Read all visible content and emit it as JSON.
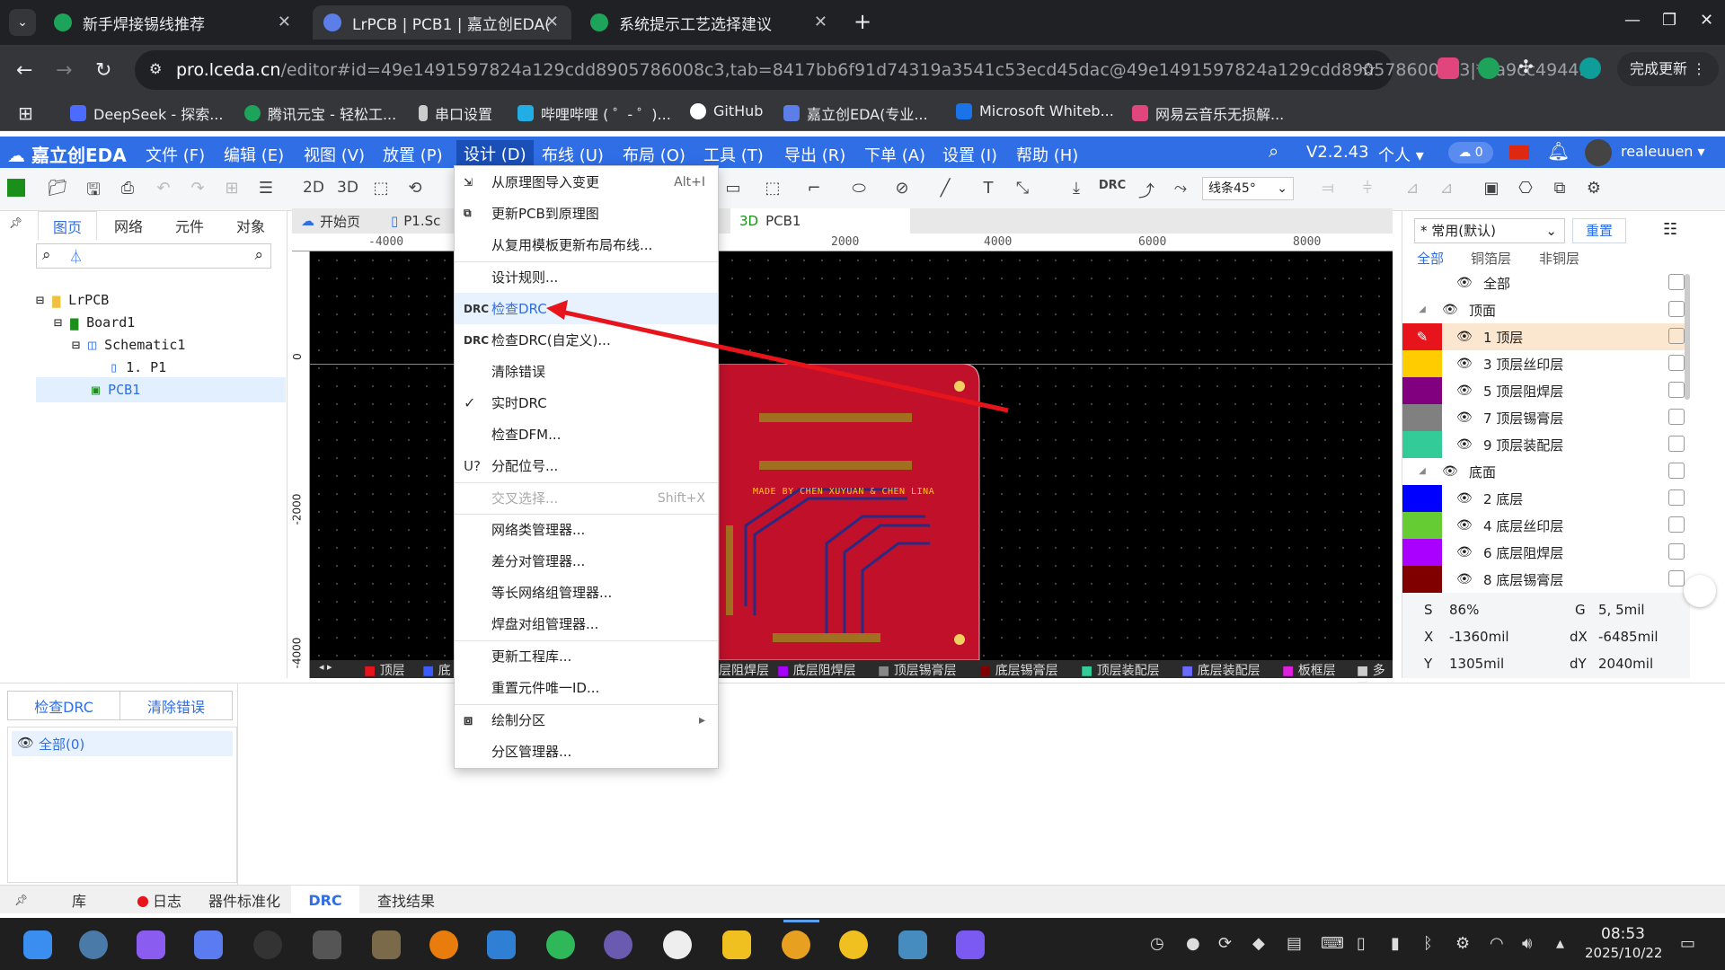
{
  "browser": {
    "tabs": [
      {
        "title": "新手焊接锡线推荐",
        "active": false
      },
      {
        "title": "LrPCB | PCB1 | 嘉立创EDA(",
        "active": true
      },
      {
        "title": "系统提示工艺选择建议",
        "active": false
      }
    ],
    "url_host": "pro.lceda.cn",
    "url_rest": "/editor#id=49e1491597824a129cdd8905786008c3,tab=8417bb6f91d74319a3541c53ecd45dac@49e1491597824a129cdd8905786008c3|*9a9cc4944...",
    "update_button": "完成更新",
    "bookmarks": [
      "DeepSeek - 探索...",
      "腾讯元宝 - 轻松工...",
      "串口设置",
      "哔哩哔哩 ( ゜- ゜)...",
      "GitHub",
      "嘉立创EDA(专业...",
      "Microsoft Whiteb...",
      "网易云音乐无损解..."
    ]
  },
  "eda": {
    "logo": "嘉立创EDA",
    "menus": [
      "文件 (F)",
      "编辑 (E)",
      "视图 (V)",
      "放置 (P)",
      "设计 (D)",
      "布线 (U)",
      "布局 (O)",
      "工具 (T)",
      "导出 (R)",
      "下单 (A)",
      "设置 (I)",
      "帮助 (H)"
    ],
    "version": "V2.2.43",
    "mode": "个人",
    "cloud_count": "0",
    "username": "realeuuen",
    "toolbar": {
      "view_2d": "2D",
      "view_3d": "3D",
      "drc_label": "DRC",
      "route_angle": "线条45°"
    }
  },
  "left_panel": {
    "tabs": [
      "图页",
      "网络",
      "元件",
      "对象"
    ],
    "tree": [
      {
        "label": "LrPCB",
        "level": 0
      },
      {
        "label": "Board1",
        "level": 1
      },
      {
        "label": "Schematic1",
        "level": 2
      },
      {
        "label": "1. P1",
        "level": 3
      },
      {
        "label": "PCB1",
        "level": 2,
        "selected": true
      }
    ]
  },
  "doc_tabs": [
    "开始页",
    "P1.Sc",
    "3D",
    "PCB1"
  ],
  "ruler": {
    "labels": [
      "-4000",
      "2000",
      "4000",
      "6000",
      "8000"
    ],
    "vlabels": [
      "0",
      "-2000",
      "-4000"
    ]
  },
  "pcb": {
    "silkscreen_text": "MADE BY CHEN XUYUAN & CHEN LINA"
  },
  "layer_strip": [
    "顶层",
    "底",
    "层阻焊层",
    "底层阻焊层",
    "顶层锡膏层",
    "底层锡膏层",
    "顶层装配层",
    "底层装配层",
    "板框层",
    "多层"
  ],
  "design_menu": {
    "items": [
      {
        "icon": "import-icon",
        "label": "从原理图导入变更",
        "shortcut": "Alt+I"
      },
      {
        "icon": "update-icon",
        "label": "更新PCB到原理图",
        "shortcut": ""
      },
      {
        "icon": "",
        "label": "从复用模板更新布局布线...",
        "shortcut": ""
      },
      {
        "icon": "",
        "label": "设计规则...",
        "shortcut": ""
      },
      {
        "icon": "DRC",
        "label": "检查DRC",
        "shortcut": ""
      },
      {
        "icon": "DRC",
        "label": "检查DRC(自定义)...",
        "shortcut": ""
      },
      {
        "icon": "",
        "label": "清除错误",
        "shortcut": ""
      },
      {
        "icon": "✓",
        "label": "实时DRC",
        "shortcut": ""
      },
      {
        "icon": "",
        "label": "检查DFM...",
        "shortcut": ""
      },
      {
        "icon": "U?",
        "label": "分配位号...",
        "shortcut": ""
      },
      {
        "icon": "",
        "label": "交叉选择...",
        "shortcut": "Shift+X"
      },
      {
        "icon": "",
        "label": "网络类管理器...",
        "shortcut": ""
      },
      {
        "icon": "",
        "label": "差分对管理器...",
        "shortcut": ""
      },
      {
        "icon": "",
        "label": "等长网络组管理器...",
        "shortcut": ""
      },
      {
        "icon": "",
        "label": "焊盘对组管理器...",
        "shortcut": ""
      },
      {
        "icon": "",
        "label": "更新工程库...",
        "shortcut": ""
      },
      {
        "icon": "",
        "label": "重置元件唯一ID...",
        "shortcut": ""
      },
      {
        "icon": "region-icon",
        "label": "绘制分区",
        "shortcut": "▸"
      },
      {
        "icon": "",
        "label": "分区管理器...",
        "shortcut": ""
      }
    ]
  },
  "right_panel": {
    "preset": "常用(默认)",
    "reset": "重置",
    "filters": [
      "全部",
      "铜箔层",
      "非铜层"
    ],
    "layers": [
      {
        "label": "全部",
        "color": ""
      },
      {
        "label": "顶面",
        "color": ""
      },
      {
        "label": "1 顶层",
        "color": "#e8141c"
      },
      {
        "label": "3 顶层丝印层",
        "color": "#ffcc00"
      },
      {
        "label": "5 顶层阻焊层",
        "color": "#800080"
      },
      {
        "label": "7 顶层锡膏层",
        "color": "#808080"
      },
      {
        "label": "9 顶层装配层",
        "color": "#33cc99"
      },
      {
        "label": "底面",
        "color": ""
      },
      {
        "label": "2 底层",
        "color": "#0000ff"
      },
      {
        "label": "4 底层丝印层",
        "color": "#66cc33"
      },
      {
        "label": "6 底层阻焊层",
        "color": "#aa00ff"
      },
      {
        "label": "8 底层锡膏层",
        "color": "#800000"
      }
    ],
    "status": {
      "s": "S",
      "s_val": "86%",
      "g": "G",
      "g_val": "5, 5mil",
      "x": "X",
      "x_val": "-1360mil",
      "dx": "dX",
      "dx_val": "-6485mil",
      "y": "Y",
      "y_val": "1305mil",
      "dy": "dY",
      "dy_val": "2040mil"
    }
  },
  "bottom": {
    "check_drc": "检查DRC",
    "clear_errors": "清除错误",
    "all_label": "全部(0)",
    "tabs": [
      "库",
      "日志",
      "器件标准化",
      "DRC",
      "查找结果"
    ]
  },
  "clock": {
    "time": "08:53",
    "date": "2025/10/22"
  }
}
